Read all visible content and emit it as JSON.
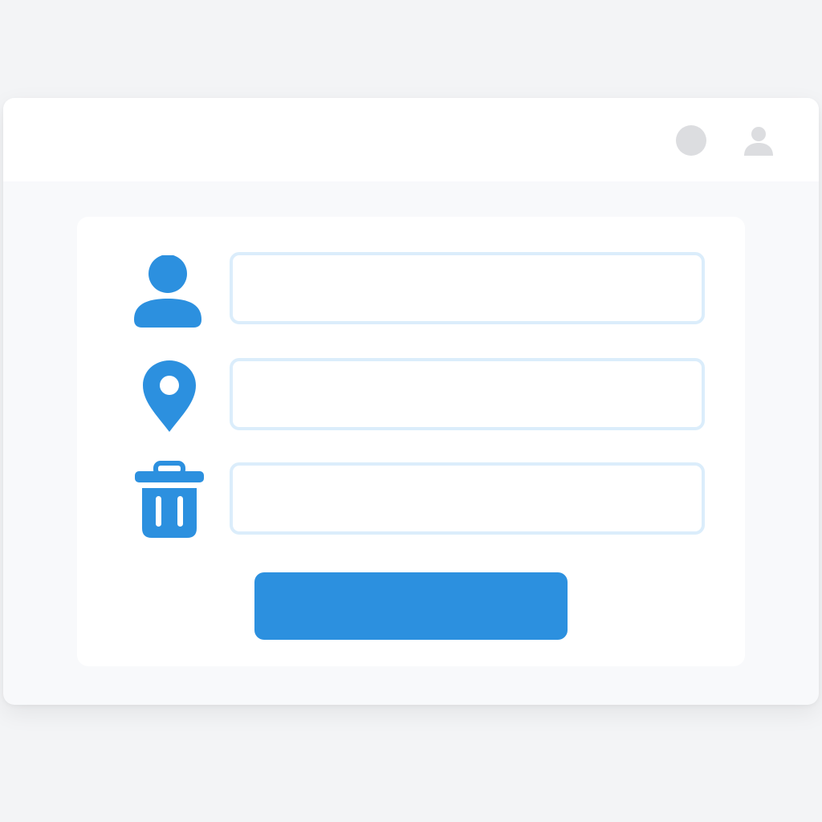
{
  "colors": {
    "accent": "#2c90df",
    "field_border": "#dbedfb",
    "header_icon": "#dcdde0"
  },
  "header": {
    "icons": [
      "circle-icon",
      "user-icon"
    ]
  },
  "form": {
    "fields": [
      {
        "icon": "user-icon",
        "value": "",
        "placeholder": ""
      },
      {
        "icon": "location-pin-icon",
        "value": "",
        "placeholder": ""
      },
      {
        "icon": "trash-icon",
        "value": "",
        "placeholder": ""
      }
    ],
    "submit_label": ""
  }
}
